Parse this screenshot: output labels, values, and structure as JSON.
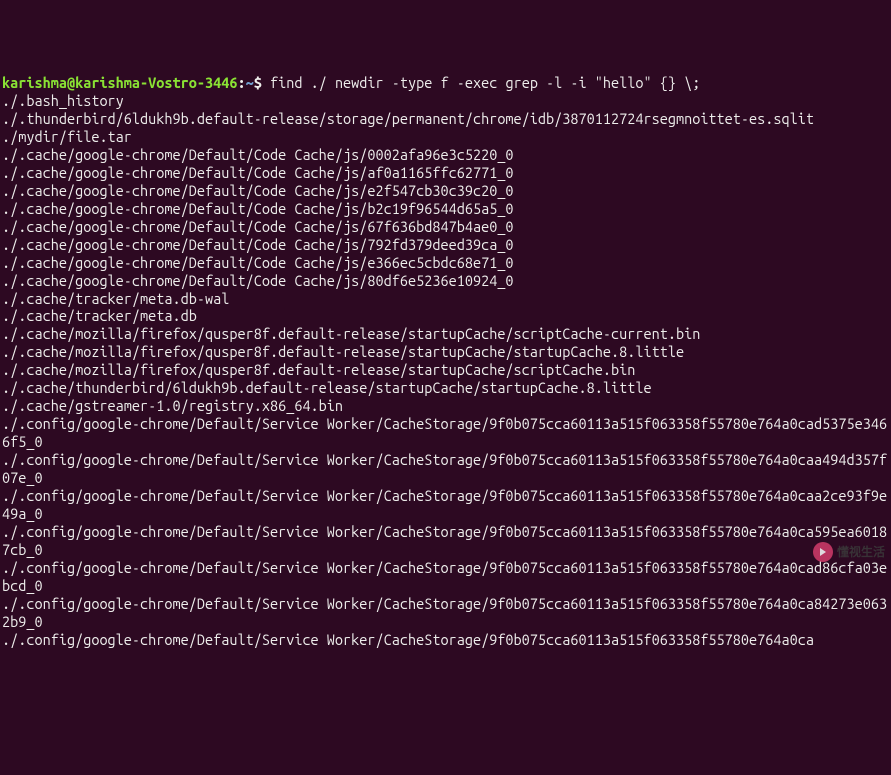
{
  "prompt": {
    "user_host": "karishma@karishma-Vostro-3446",
    "path": "~",
    "dollar": "$"
  },
  "command": " find ./ newdir -type f -exec grep -l -i \"hello\" {} \\;",
  "output_lines": [
    "./.bash_history",
    "./.thunderbird/6ldukh9b.default-release/storage/permanent/chrome/idb/3870112724rsegmnoittet-es.sqlit",
    "./mydir/file.tar",
    "./.cache/google-chrome/Default/Code Cache/js/0002afa96e3c5220_0",
    "./.cache/google-chrome/Default/Code Cache/js/af0a1165ffc62771_0",
    "./.cache/google-chrome/Default/Code Cache/js/e2f547cb30c39c20_0",
    "./.cache/google-chrome/Default/Code Cache/js/b2c19f96544d65a5_0",
    "./.cache/google-chrome/Default/Code Cache/js/67f636bd847b4ae0_0",
    "./.cache/google-chrome/Default/Code Cache/js/792fd379deed39ca_0",
    "./.cache/google-chrome/Default/Code Cache/js/e366ec5cbdc68e71_0",
    "./.cache/google-chrome/Default/Code Cache/js/80df6e5236e10924_0",
    "./.cache/tracker/meta.db-wal",
    "./.cache/tracker/meta.db",
    "./.cache/mozilla/firefox/qusper8f.default-release/startupCache/scriptCache-current.bin",
    "./.cache/mozilla/firefox/qusper8f.default-release/startupCache/startupCache.8.little",
    "./.cache/mozilla/firefox/qusper8f.default-release/startupCache/scriptCache.bin",
    "./.cache/thunderbird/6ldukh9b.default-release/startupCache/startupCache.8.little",
    "./.cache/gstreamer-1.0/registry.x86_64.bin",
    "./.config/google-chrome/Default/Service Worker/CacheStorage/9f0b075cca60113a515f063358f55780e764a0cad5375e3466f5_0",
    "./.config/google-chrome/Default/Service Worker/CacheStorage/9f0b075cca60113a515f063358f55780e764a0caa494d357f07e_0",
    "./.config/google-chrome/Default/Service Worker/CacheStorage/9f0b075cca60113a515f063358f55780e764a0caa2ce93f9e49a_0",
    "./.config/google-chrome/Default/Service Worker/CacheStorage/9f0b075cca60113a515f063358f55780e764a0ca595ea60187cb_0",
    "./.config/google-chrome/Default/Service Worker/CacheStorage/9f0b075cca60113a515f063358f55780e764a0cad86cfa03ebcd_0",
    "./.config/google-chrome/Default/Service Worker/CacheStorage/9f0b075cca60113a515f063358f55780e764a0ca84273e0632b9_0",
    "./.config/google-chrome/Default/Service Worker/CacheStorage/9f0b075cca60113a515f063358f55780e764a0ca"
  ],
  "watermark": {
    "text": "懂视生活"
  }
}
